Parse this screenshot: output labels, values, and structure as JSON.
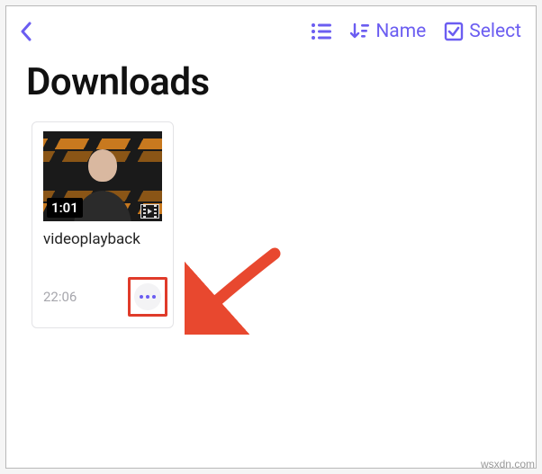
{
  "toolbar": {
    "sort_label": "Name",
    "select_label": "Select"
  },
  "page": {
    "title": "Downloads"
  },
  "file": {
    "name": "videoplayback",
    "duration": "1:01",
    "timestamp": "22:06"
  },
  "watermark": "wsxdn.com",
  "colors": {
    "accent": "#6b5df1",
    "highlight": "#e03b2a"
  }
}
